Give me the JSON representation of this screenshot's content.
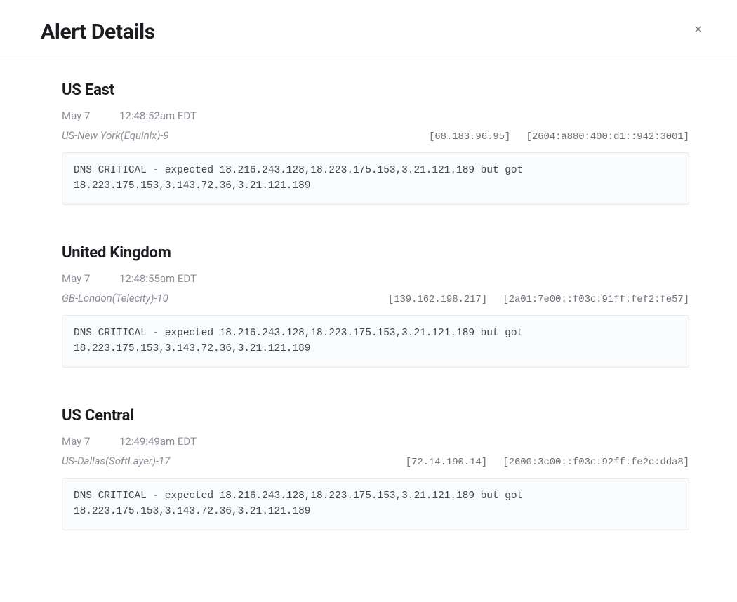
{
  "header": {
    "title": "Alert Details",
    "close_glyph": "×"
  },
  "alerts": [
    {
      "region": "US East",
      "date": "May 7",
      "time": "12:48:52am EDT",
      "location": "US-New York(Equinix)-9",
      "ipv4": "[68.183.96.95]",
      "ipv6": "[2604:a880:400:d1::942:3001]",
      "message": "DNS CRITICAL - expected 18.216.243.128,18.223.175.153,3.21.121.189 but got 18.223.175.153,3.143.72.36,3.21.121.189"
    },
    {
      "region": "United Kingdom",
      "date": "May 7",
      "time": "12:48:55am EDT",
      "location": "GB-London(Telecity)-10",
      "ipv4": "[139.162.198.217]",
      "ipv6": "[2a01:7e00::f03c:91ff:fef2:fe57]",
      "message": "DNS CRITICAL - expected 18.216.243.128,18.223.175.153,3.21.121.189 but got 18.223.175.153,3.143.72.36,3.21.121.189"
    },
    {
      "region": "US Central",
      "date": "May 7",
      "time": "12:49:49am EDT",
      "location": "US-Dallas(SoftLayer)-17",
      "ipv4": "[72.14.190.14]",
      "ipv6": "[2600:3c00::f03c:92ff:fe2c:dda8]",
      "message": "DNS CRITICAL - expected 18.216.243.128,18.223.175.153,3.21.121.189 but got 18.223.175.153,3.143.72.36,3.21.121.189"
    }
  ]
}
